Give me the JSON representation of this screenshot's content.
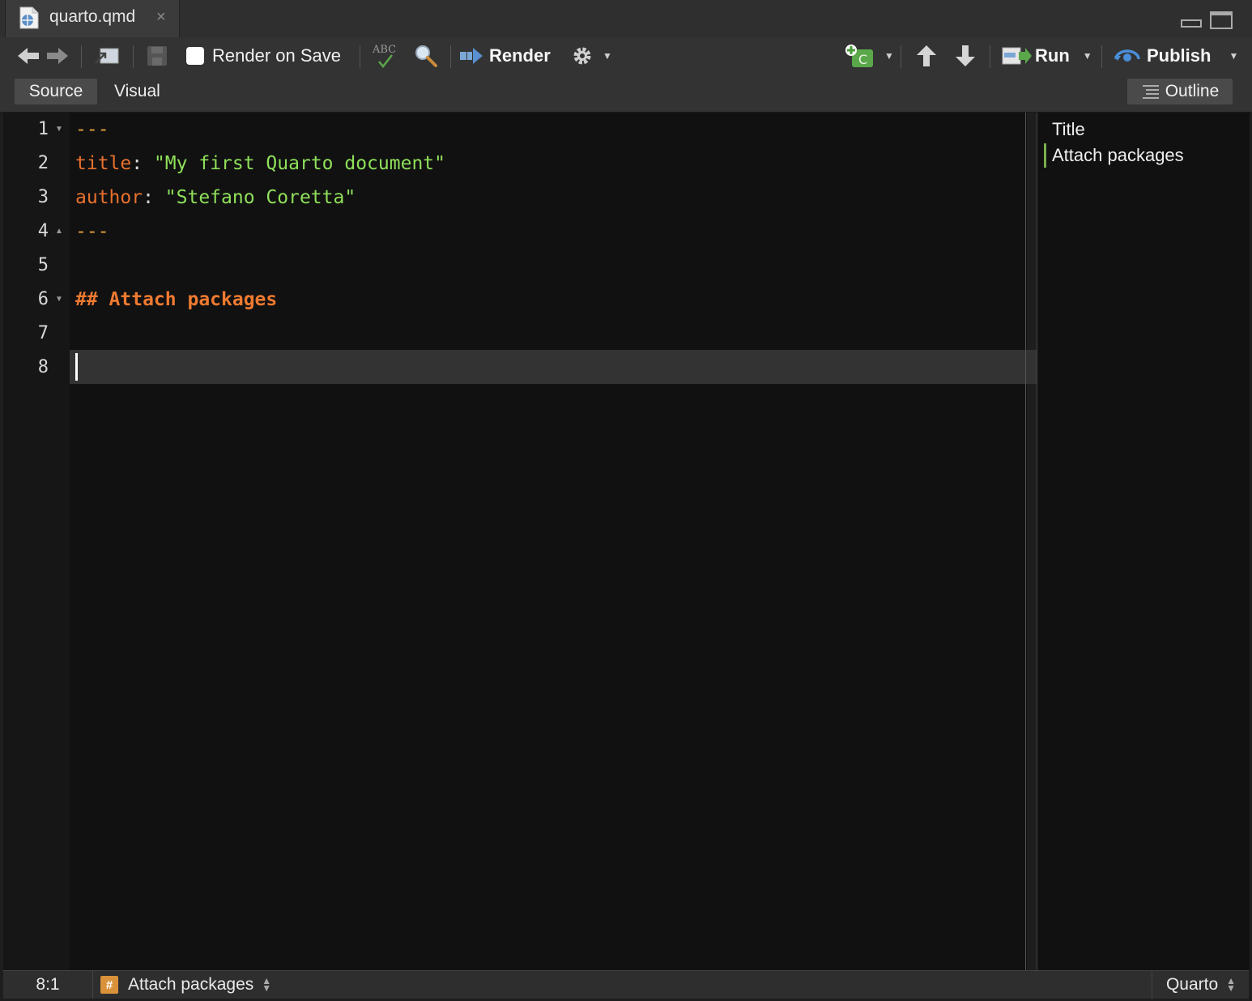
{
  "tab": {
    "filename": "quarto.qmd",
    "close": "×"
  },
  "toolbar": {
    "render_on_save_label": "Render on Save",
    "render_label": "Render",
    "run_label": "Run",
    "publish_label": "Publish",
    "spellcheck_label": "ABC",
    "chunk_letter": "C"
  },
  "modes": {
    "source": "Source",
    "visual": "Visual",
    "outline": "Outline"
  },
  "editor": {
    "lines": [
      {
        "num": "1",
        "dash": "---"
      },
      {
        "num": "2",
        "key": "title",
        "colon": ": ",
        "value": "\"My first Quarto document\""
      },
      {
        "num": "3",
        "key": "author",
        "colon": ": ",
        "value": "\"Stefano Coretta\""
      },
      {
        "num": "4",
        "dash": "---"
      },
      {
        "num": "5"
      },
      {
        "num": "6",
        "heading": "## Attach packages"
      },
      {
        "num": "7"
      },
      {
        "num": "8"
      }
    ]
  },
  "outline": {
    "items": [
      "Title",
      "Attach packages"
    ]
  },
  "status": {
    "position": "8:1",
    "section": "Attach packages",
    "section_badge": "#",
    "language": "Quarto"
  },
  "colors": {
    "accent_green": "#8fe05a",
    "yaml_key": "#e8702e",
    "heading": "#ef7a30",
    "outline_marker": "#7ab04a"
  }
}
